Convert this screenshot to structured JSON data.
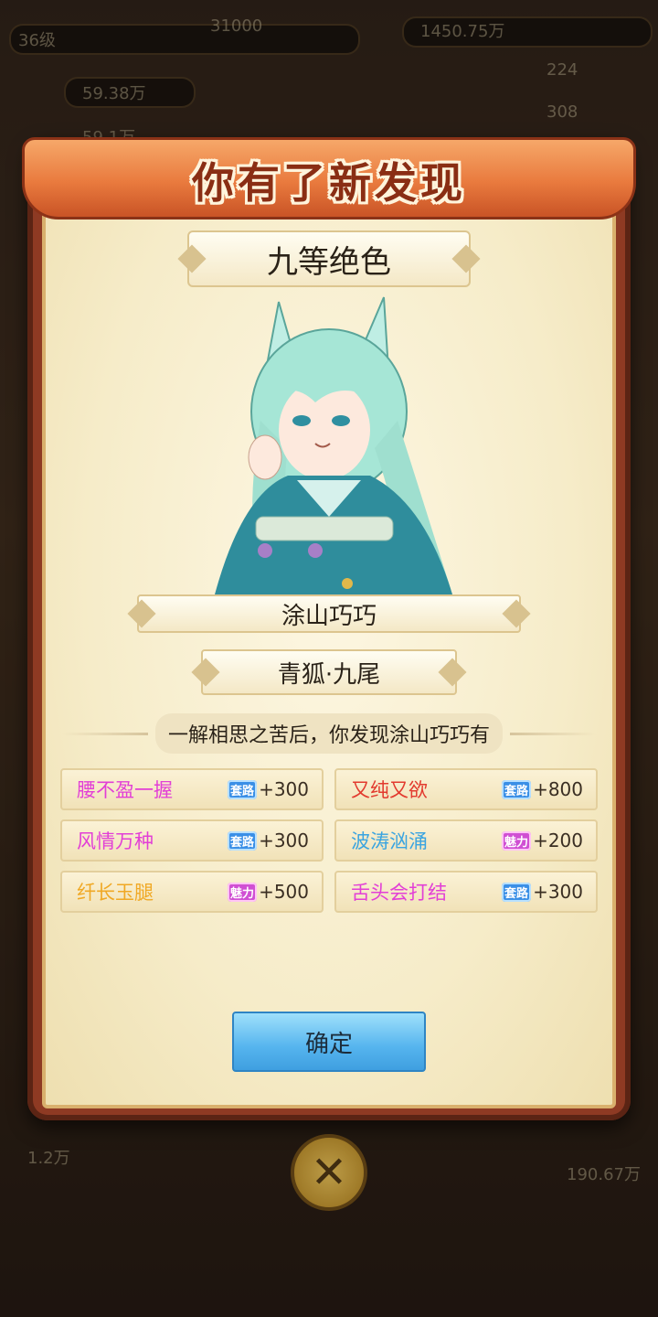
{
  "hud": {
    "level": "36级",
    "resource_1": "31000",
    "resource_2": "1450.75万",
    "stat_1": "59.38万",
    "stat_2": "59.1万",
    "stat_3": "224",
    "stat_4": "308",
    "bottom_left": "1.2万",
    "bottom_right": "190.67万"
  },
  "dialog": {
    "banner_title": "你有了新发现",
    "rank": "九等绝色",
    "character_name": "涂山巧巧",
    "character_title": "青狐·九尾",
    "discovery_text": "一解相思之苦后，你发现涂山巧巧有",
    "traits": [
      {
        "name": "腰不盈一握",
        "name_color": "#e23fd6",
        "tag": "套路",
        "tag_type": "taolu",
        "value": "+300"
      },
      {
        "name": "又纯又欲",
        "name_color": "#e23a2e",
        "tag": "套路",
        "tag_type": "taolu",
        "value": "+800"
      },
      {
        "name": "风情万种",
        "name_color": "#e23fd6",
        "tag": "套路",
        "tag_type": "taolu",
        "value": "+300"
      },
      {
        "name": "波涛汹涌",
        "name_color": "#3aa4e0",
        "tag": "魅力",
        "tag_type": "meili",
        "value": "+200"
      },
      {
        "name": "纤长玉腿",
        "name_color": "#f0a824",
        "tag": "魅力",
        "tag_type": "meili",
        "value": "+500"
      },
      {
        "name": "舌头会打结",
        "name_color": "#e23fd6",
        "tag": "套路",
        "tag_type": "taolu",
        "value": "+300"
      }
    ],
    "confirm_label": "确定"
  },
  "colors": {
    "frame": "#8e3a23",
    "banner": "#e97a3e",
    "parchment": "#f6ecc9",
    "confirm": "#55b4ee"
  },
  "icons": {
    "close": "close-icon",
    "tag_taolu": "taolu-badge-icon",
    "tag_meili": "meili-badge-icon"
  }
}
